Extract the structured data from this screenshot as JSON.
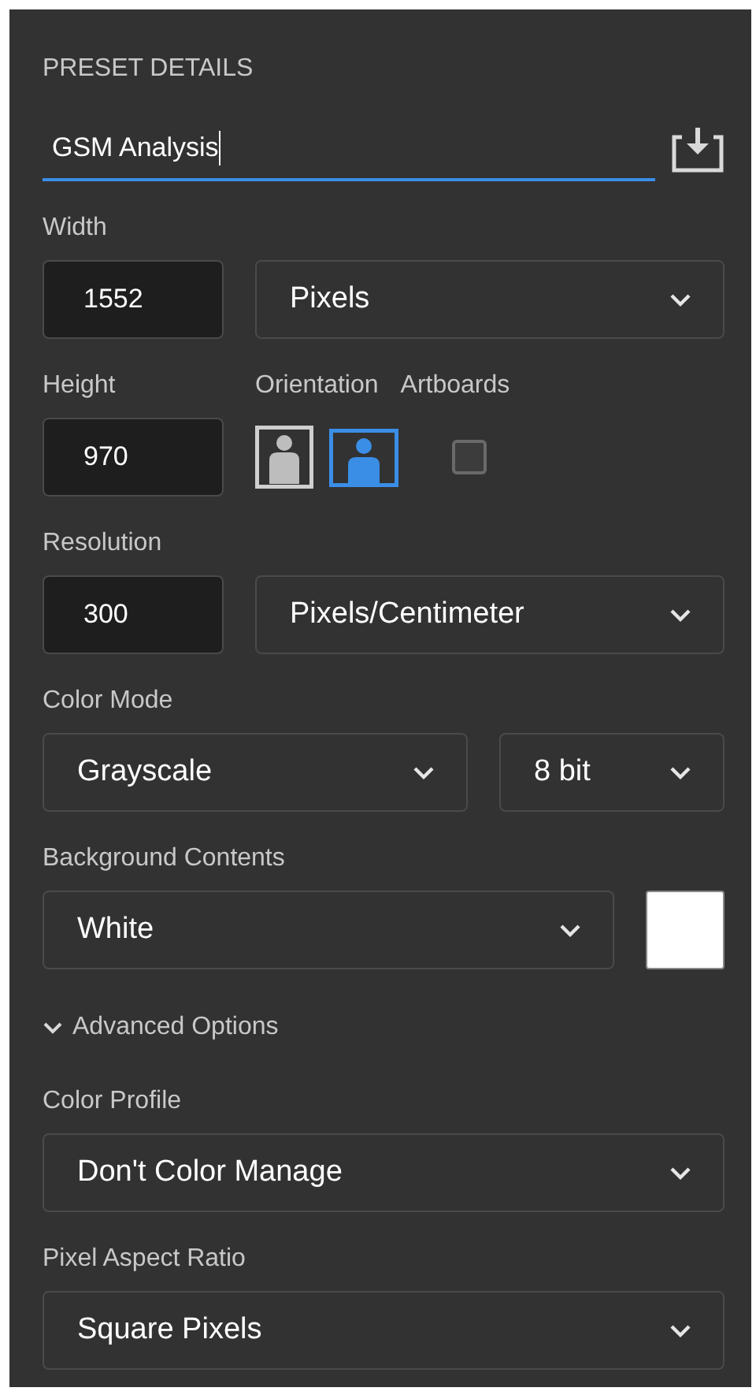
{
  "panel": {
    "title": "PRESET DETAILS",
    "preset_name": {
      "value": "GSM Analysis",
      "focused": true
    },
    "width": {
      "label": "Width",
      "value": "1552",
      "unit": "Pixels"
    },
    "height": {
      "label": "Height",
      "value": "970"
    },
    "orientation": {
      "label": "Orientation",
      "options": [
        {
          "kind": "portrait",
          "selected": false
        },
        {
          "kind": "landscape",
          "selected": true
        }
      ]
    },
    "artboards": {
      "label": "Artboards",
      "checked": false
    },
    "resolution": {
      "label": "Resolution",
      "value": "300",
      "unit": "Pixels/Centimeter"
    },
    "color_mode": {
      "label": "Color Mode",
      "mode": "Grayscale",
      "depth": "8 bit"
    },
    "background_contents": {
      "label": "Background Contents",
      "value": "White",
      "color": "#ffffff"
    },
    "advanced_options": {
      "label": "Advanced Options",
      "expanded": true
    },
    "color_profile": {
      "label": "Color Profile",
      "value": "Don't Color Manage"
    },
    "pixel_aspect_ratio": {
      "label": "Pixel Aspect Ratio",
      "value": "Square Pixels"
    }
  }
}
